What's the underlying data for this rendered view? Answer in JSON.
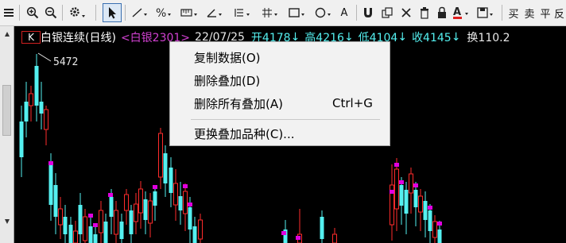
{
  "toolbar": {
    "items": [
      {
        "name": "bars-menu-icon"
      },
      {
        "name": "zoom-in-icon"
      },
      {
        "name": "zoom-out-icon"
      },
      {
        "name": "settings-gear-icon"
      },
      {
        "name": "cursor-arrow-icon"
      },
      {
        "name": "line-tool-icon"
      },
      {
        "name": "percent-tool-icon"
      },
      {
        "name": "ruler-tool-icon"
      },
      {
        "name": "angle-tool-icon"
      },
      {
        "name": "parallel-lines-icon"
      },
      {
        "name": "grid-tool-icon"
      },
      {
        "name": "rectangle-tool-icon"
      },
      {
        "name": "circle-tool-icon"
      },
      {
        "name": "text-tool-icon"
      },
      {
        "name": "magnet-icon"
      },
      {
        "name": "copy-icon"
      },
      {
        "name": "delete-x-icon"
      },
      {
        "name": "trash-icon"
      },
      {
        "name": "lock-icon"
      },
      {
        "name": "font-color-icon"
      },
      {
        "name": "save-icon"
      }
    ],
    "text_a": "A",
    "buy_label": "买",
    "sell_label": "卖",
    "flat_label": "平",
    "last_label": "反"
  },
  "info": {
    "k_badge": "K",
    "stock_name": "白银连续(日线)",
    "overlay_label": "<白银2301>",
    "date": "22/07/25",
    "open": "开4178",
    "open_arrow": "↓",
    "high": "高4216",
    "high_arrow": "↓",
    "low": "低4104",
    "low_arrow": "↓",
    "close": "收4145",
    "close_arrow": "↓",
    "turnover": "换110.2"
  },
  "chart": {
    "marker_value": "5472",
    "colors": {
      "up": "#ff2b2b",
      "down": "#54f0f0",
      "magenta": "#e000e0",
      "background": "#000000"
    }
  },
  "context_menu": {
    "items": [
      {
        "label": "复制数据(O)",
        "shortcut": ""
      },
      {
        "label": "删除叠加(D)",
        "shortcut": ""
      },
      {
        "label": "删除所有叠加(A)",
        "shortcut": "Ctrl+G"
      },
      {
        "label": "更换叠加品种(C)...",
        "shortcut": ""
      }
    ]
  }
}
